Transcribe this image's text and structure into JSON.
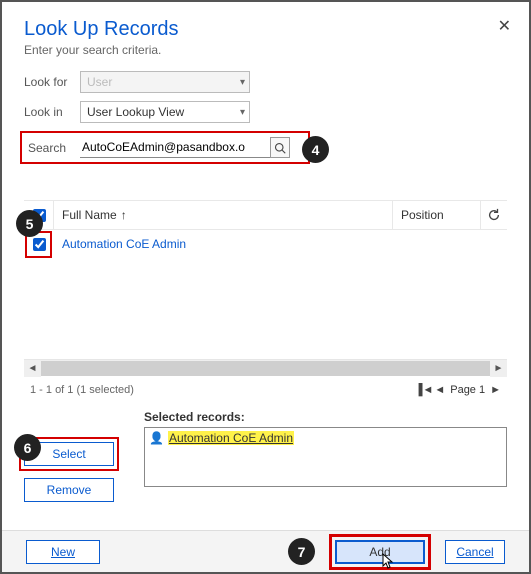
{
  "dialog": {
    "title": "Look Up Records",
    "subtitle": "Enter your search criteria."
  },
  "form": {
    "look_for_label": "Look for",
    "look_for_value": "User",
    "look_in_label": "Look in",
    "look_in_value": "User Lookup View",
    "search_label": "Search",
    "search_value": "AutoCoEAdmin@pasandbox.o"
  },
  "grid": {
    "columns": {
      "full_name": "Full Name",
      "position": "Position"
    },
    "sort_indicator": "↑",
    "rows": [
      {
        "checked": true,
        "full_name": "Automation CoE Admin",
        "position": ""
      }
    ]
  },
  "pager": {
    "status": "1 - 1 of 1 (1 selected)",
    "page_label": "Page 1"
  },
  "selected": {
    "label": "Selected records:",
    "items": [
      "Automation CoE Admin"
    ]
  },
  "buttons": {
    "select": "Select",
    "remove": "Remove",
    "new": "New",
    "add": "Add",
    "cancel": "Cancel"
  },
  "annotations": {
    "a4": "4",
    "a5": "5",
    "a6": "6",
    "a7": "7"
  }
}
